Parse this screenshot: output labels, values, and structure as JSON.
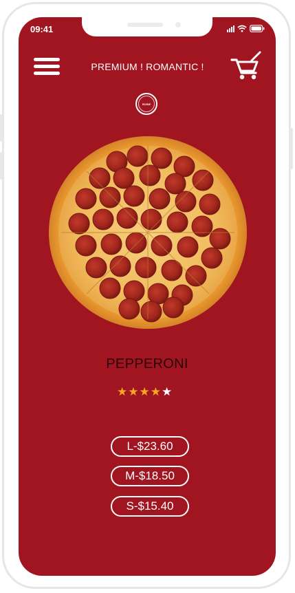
{
  "status_bar": {
    "time": "09:41"
  },
  "header": {
    "title": "PREMIUM ! ROMANTIC !"
  },
  "logo": {
    "text": "ROSIE"
  },
  "product": {
    "name": "PEPPERONI",
    "rating": 4,
    "rating_max": 5
  },
  "prices": [
    {
      "label": "L-$23.60"
    },
    {
      "label": "M-$18.50"
    },
    {
      "label": "S-$15.40"
    }
  ],
  "colors": {
    "background": "#a11520",
    "star_filled": "#f5a623",
    "star_empty": "#ffffff",
    "text_light": "#ffffff",
    "text_dark": "#2a0508"
  },
  "icons": {
    "menu": "hamburger-menu-icon",
    "cart": "shopping-cart-icon",
    "star": "star-icon"
  }
}
